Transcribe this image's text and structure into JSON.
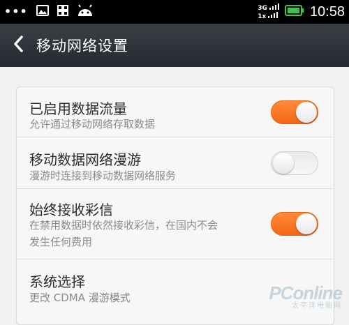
{
  "status_bar": {
    "dots": "•••",
    "network_type_top": "3G",
    "network_type_bottom": "1x",
    "battery_level": 0.9,
    "time": "10:58",
    "icons": [
      "image-icon",
      "grid-icon",
      "android-icon",
      "signal-icon",
      "battery-icon"
    ]
  },
  "title_bar": {
    "title": "移动网络设置",
    "back_icon": "chevron-left-icon"
  },
  "settings": {
    "items": [
      {
        "title": "已启用数据流量",
        "subtitle": "允许通过移动网络存取数据",
        "toggle": "on"
      },
      {
        "title": "移动数据网络漫游",
        "subtitle": "漫游时连接到移动数据网络服务",
        "toggle": "off"
      },
      {
        "title": "始终接收彩信",
        "subtitle_line1": "在禁用数据时依然接收彩信，在国内不会",
        "subtitle_line2": "发生任何费用",
        "toggle": "on"
      },
      {
        "title": "系统选择",
        "subtitle": "更改 CDMA 漫游模式"
      }
    ]
  },
  "watermark": {
    "brand": "PConline",
    "tagline": "太平洋电脑网"
  },
  "colors": {
    "accent": "#f26a12",
    "status_bar": "#000000",
    "title_bar": "#2f3339",
    "battery": "#3fc34a"
  }
}
